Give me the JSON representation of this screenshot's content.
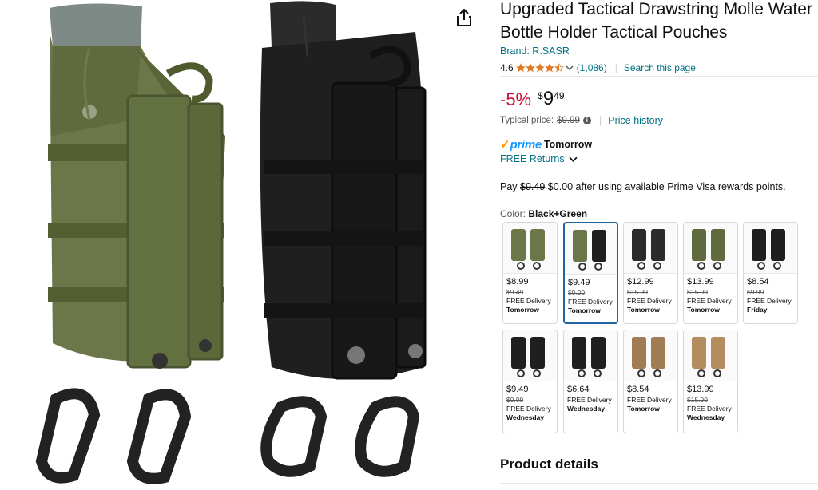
{
  "product": {
    "title": "Upgraded Tactical Drawstring Molle Water Bottle Holder Tactical Pouches",
    "brand": "Brand: R.SASR",
    "rating": "4.6",
    "stars": 4.5,
    "review_count": "(1,086)",
    "search_page": "Search this page"
  },
  "price": {
    "discount": "-5%",
    "symbol": "$",
    "whole": "9",
    "fraction": "49",
    "typical_label": "Typical price:",
    "typical_value": "$9.99",
    "history_link": "Price history"
  },
  "delivery": {
    "prime_check": "✓",
    "prime_word": "prime",
    "prime_day": "Tomorrow",
    "returns": "FREE Returns"
  },
  "pay": {
    "prefix": "Pay",
    "struck": "$9.49",
    "rest": "$0.00 after using available Prime Visa rewards points."
  },
  "color": {
    "label": "Color:",
    "value": "Black+Green"
  },
  "swatches": [
    {
      "price": "$8.99",
      "list": "$9.49",
      "delivery": "FREE Delivery",
      "when": "Tomorrow",
      "selected": false
    },
    {
      "price": "$9.49",
      "list": "$9.99",
      "delivery": "FREE Delivery",
      "when": "Tomorrow",
      "selected": true
    },
    {
      "price": "$12.99",
      "list": "$15.99",
      "delivery": "FREE Delivery",
      "when": "Tomorrow",
      "selected": false
    },
    {
      "price": "$13.99",
      "list": "$15.99",
      "delivery": "FREE Delivery",
      "when": "Tomorrow",
      "selected": false
    },
    {
      "price": "$8.54",
      "list": "$9.99",
      "delivery": "FREE Delivery",
      "when": "Friday",
      "selected": false
    },
    {
      "price": "$9.49",
      "list": "$9.99",
      "delivery": "FREE Delivery",
      "when": "Wednesday",
      "selected": false
    },
    {
      "price": "$6.64",
      "list": "",
      "delivery": "FREE Delivery",
      "when": "Wednesday",
      "selected": false
    },
    {
      "price": "$8.54",
      "list": "",
      "delivery": "FREE Delivery",
      "when": "Tomorrow",
      "selected": false
    },
    {
      "price": "$13.99",
      "list": "$15.99",
      "delivery": "FREE Delivery",
      "when": "Wednesday",
      "selected": false
    }
  ],
  "section": {
    "details_heading": "Product details"
  },
  "colors": {
    "link": "#007185",
    "discount": "#cc0c39",
    "prime_blue": "#1399ff",
    "prime_orange": "#ff9900",
    "selected_border": "#2162a1"
  },
  "icons": {
    "share": "share-icon",
    "star": "star-icon",
    "chevron": "chevron-down-icon",
    "info": "info-icon"
  }
}
